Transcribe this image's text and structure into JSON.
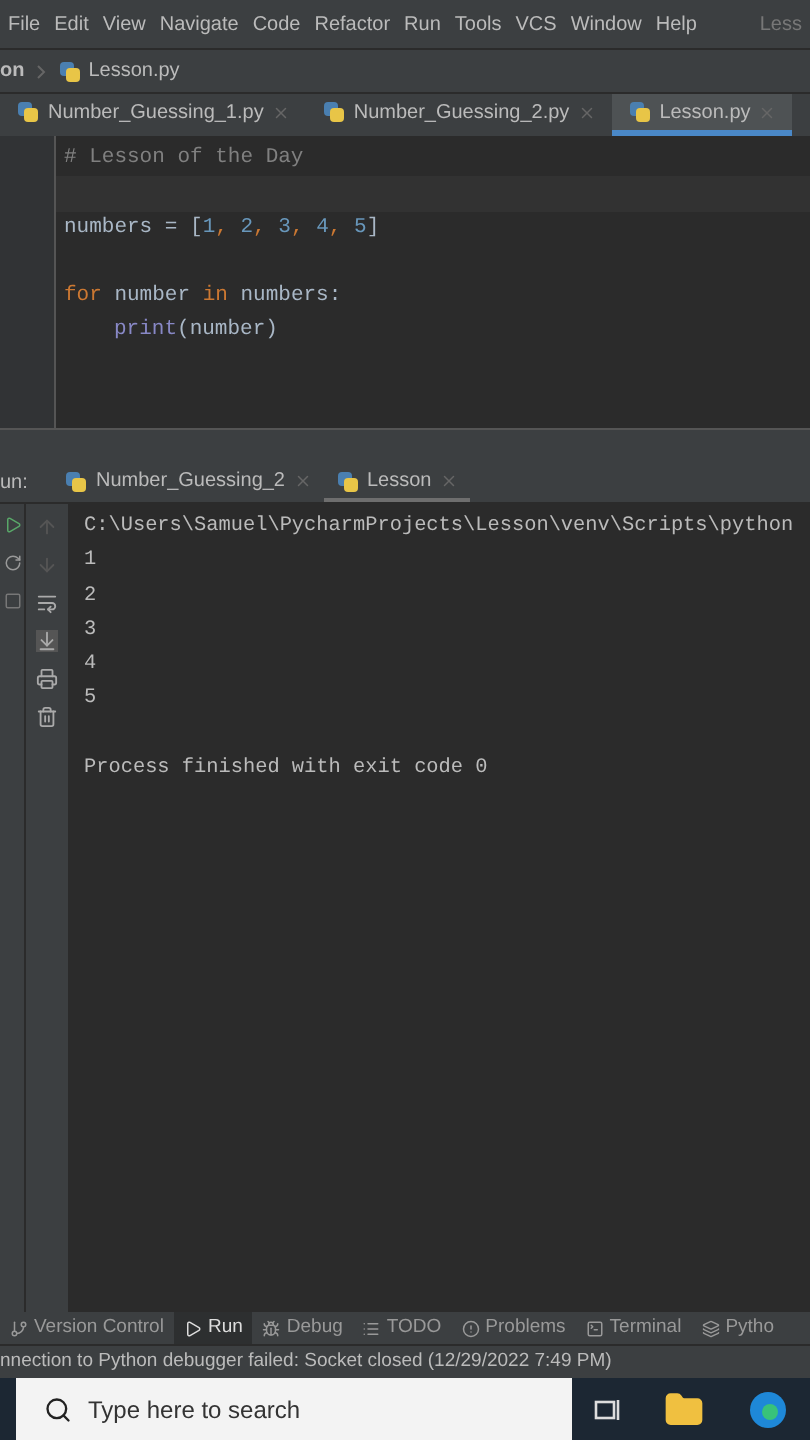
{
  "menu": [
    "File",
    "Edit",
    "View",
    "Navigate",
    "Code",
    "Refactor",
    "Run",
    "Tools",
    "VCS",
    "Window",
    "Help"
  ],
  "window_title": "Less",
  "breadcrumb": {
    "project": "on",
    "file": "Lesson.py"
  },
  "editor_tabs": [
    {
      "label": "Number_Guessing_1.py",
      "selected": false
    },
    {
      "label": "Number_Guessing_2.py",
      "selected": false
    },
    {
      "label": "Lesson.py",
      "selected": true
    }
  ],
  "code": [
    {
      "tokens": [
        {
          "kind": "comment",
          "text": "# Lesson of the Day"
        }
      ]
    },
    {
      "gap_before": true,
      "tokens": [
        {
          "kind": "plain",
          "text": "numbers = ["
        },
        {
          "kind": "number",
          "text": "1"
        },
        {
          "kind": "punct",
          "text": ", "
        },
        {
          "kind": "number",
          "text": "2"
        },
        {
          "kind": "punct",
          "text": ", "
        },
        {
          "kind": "number",
          "text": "3"
        },
        {
          "kind": "punct",
          "text": ", "
        },
        {
          "kind": "number",
          "text": "4"
        },
        {
          "kind": "punct",
          "text": ", "
        },
        {
          "kind": "number",
          "text": "5"
        },
        {
          "kind": "plain",
          "text": "]"
        }
      ]
    },
    {
      "gap_before": true,
      "tokens": [
        {
          "kind": "keyword",
          "text": "for"
        },
        {
          "kind": "plain",
          "text": " number "
        },
        {
          "kind": "keyword",
          "text": "in"
        },
        {
          "kind": "plain",
          "text": " numbers:"
        }
      ]
    },
    {
      "indented": true,
      "tokens": [
        {
          "kind": "builtin",
          "text": "print"
        },
        {
          "kind": "plain",
          "text": "(number)"
        }
      ]
    }
  ],
  "run_panel": {
    "label": "un:",
    "tabs": [
      {
        "label": "Number_Guessing_2",
        "selected": false
      },
      {
        "label": "Lesson",
        "selected": true
      }
    ],
    "output": [
      "C:\\Users\\Samuel\\PycharmProjects\\Lesson\\venv\\Scripts\\python",
      "1",
      "2",
      "3",
      "4",
      "5"
    ],
    "exit_message": "Process finished with exit code 0"
  },
  "tool_windows": [
    {
      "label": "Version Control",
      "kind": "vcs",
      "selected": false
    },
    {
      "label": "Run",
      "kind": "run",
      "selected": true
    },
    {
      "label": "Debug",
      "kind": "debug",
      "selected": false
    },
    {
      "label": "TODO",
      "kind": "todo",
      "selected": false
    },
    {
      "label": "Problems",
      "kind": "problems",
      "selected": false
    },
    {
      "label": "Terminal",
      "kind": "terminal",
      "selected": false
    },
    {
      "label": "Pytho",
      "kind": "python",
      "selected": false
    }
  ],
  "status_bar": "nnection to Python debugger failed: Socket closed (12/29/2022 7:49 PM)",
  "taskbar": {
    "search_placeholder": "Type here to search"
  }
}
